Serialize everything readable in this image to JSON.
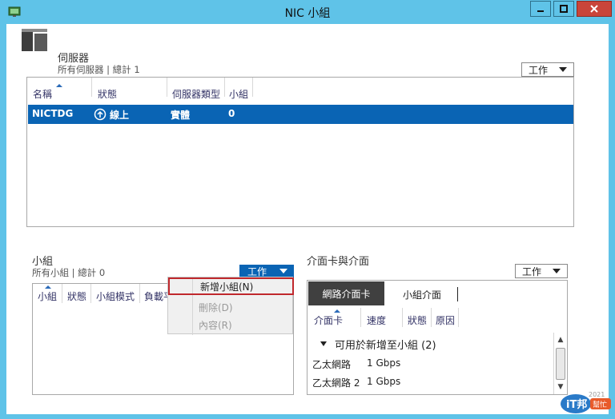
{
  "window": {
    "title": "NIC 小組"
  },
  "servers": {
    "title": "伺服器",
    "subtitle": "所有伺服器 | 總計 1",
    "task_label": "工作",
    "columns": [
      "名稱",
      "狀態",
      "伺服器類型",
      "小組"
    ],
    "rows": [
      {
        "name": "NICTDG",
        "status": "線上",
        "type": "實體",
        "team": "0"
      }
    ]
  },
  "teams": {
    "title": "小組",
    "subtitle": "所有小組 | 總計 0",
    "task_label": "工作",
    "columns": [
      "小組",
      "狀態",
      "小組模式",
      "負載平"
    ],
    "menu": [
      {
        "label": "新增小組(N)",
        "enabled": true
      },
      {
        "label": "刪除(D)",
        "enabled": false
      },
      {
        "label": "內容(R)",
        "enabled": false
      }
    ]
  },
  "adapters": {
    "title": "介面卡與介面",
    "task_label": "工作",
    "tabs": [
      "網路介面卡",
      "小組介面"
    ],
    "columns": [
      "介面卡",
      "速度",
      "狀態",
      "原因"
    ],
    "group_label": "可用於新增至小組 (2)",
    "rows": [
      {
        "name": "乙太網路",
        "speed": "1 Gbps"
      },
      {
        "name": "乙太網路 2",
        "speed": "1 Gbps"
      }
    ]
  },
  "watermark": {
    "text": "iT邦幫忙",
    "badge": "2021"
  },
  "colors": {
    "titlebar": "#5fc3e8",
    "selection": "#0a64b4",
    "close": "#c9453a",
    "menu_highlight_border": "#c0282d"
  }
}
